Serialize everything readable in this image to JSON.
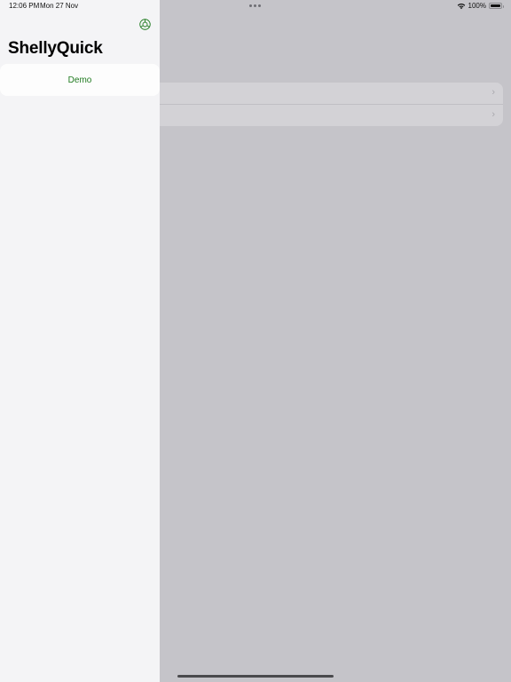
{
  "status_bar": {
    "time": "12:06 PM",
    "date": "Mon 27 Nov",
    "battery": "100%",
    "battery_level": 1.0
  },
  "sidebar": {
    "title": "ShellyQuick",
    "settings_icon": "settings-icon",
    "accent_color": "#1f7a1f",
    "items": [
      {
        "label": "Demo"
      }
    ]
  },
  "detail": {
    "rows": [
      {
        "chevron": "›"
      },
      {
        "chevron": "›"
      }
    ]
  }
}
